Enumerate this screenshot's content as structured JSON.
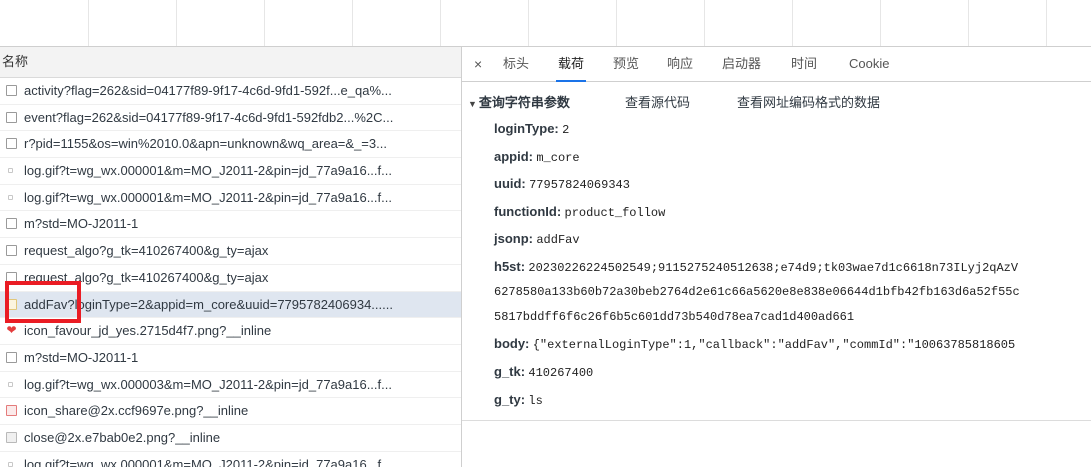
{
  "list": {
    "header": "名称",
    "rows": [
      {
        "name": "activity?flag=262&sid=04177f89-9f17-4c6d-9fd1-592f...e_qa%...",
        "icon": "document-icon"
      },
      {
        "name": "event?flag=262&sid=04177f89-9f17-4c6d-9fd1-592fdb2...%2C...",
        "icon": "document-icon"
      },
      {
        "name": "r?pid=1155&os=win%2010.0&apn=unknown&wq_area=&_=3...",
        "icon": "document-icon"
      },
      {
        "name": "log.gif?t=wg_wx.000001&m=MO_J2011-2&pin=jd_77a9a16...f...",
        "icon": "pixel-icon"
      },
      {
        "name": "log.gif?t=wg_wx.000001&m=MO_J2011-2&pin=jd_77a9a16...f...",
        "icon": "pixel-icon"
      },
      {
        "name": "m?std=MO-J2011-1",
        "icon": "document-icon"
      },
      {
        "name": "request_algo?g_tk=410267400&g_ty=ajax",
        "icon": "document-icon"
      },
      {
        "name": "request_algo?g_tk=410267400&g_ty=ajax",
        "icon": "document-icon"
      },
      {
        "name": "addFav?loginType=2&appid=m_core&uuid=7795782406934......",
        "icon": "script-icon"
      },
      {
        "name": "icon_favour_jd_yes.2715d4f7.png?__inline",
        "icon": "heart-icon"
      },
      {
        "name": "m?std=MO-J2011-1",
        "icon": "document-icon"
      },
      {
        "name": "log.gif?t=wg_wx.000003&m=MO_J2011-2&pin=jd_77a9a16...f...",
        "icon": "pixel-icon"
      },
      {
        "name": "icon_share@2x.ccf9697e.png?__inline",
        "icon": "image-icon"
      },
      {
        "name": "close@2x.e7bab0e2.png?__inline",
        "icon": "image-icon"
      },
      {
        "name": "log.gif?t=wg_wx.000001&m=MO_J2011-2&pin=jd_77a9a16...f...",
        "icon": "pixel-icon"
      }
    ]
  },
  "tabs": {
    "close": "×",
    "headers": "标头",
    "payload": "载荷",
    "preview": "预览",
    "response": "响应",
    "initiator": "启动器",
    "timing": "时间",
    "cookie": "Cookie"
  },
  "payload": {
    "section_title": "查询字符串参数",
    "view_source": "查看源代码",
    "view_url_encoded": "查看网址编码格式的数据",
    "params": [
      {
        "key": "loginType:",
        "value": "2"
      },
      {
        "key": "appid:",
        "value": "m_core"
      },
      {
        "key": "uuid:",
        "value": "77957824069343"
      },
      {
        "key": "functionId:",
        "value": "product_follow"
      },
      {
        "key": "jsonp:",
        "value": "addFav"
      },
      {
        "key": "h5st:",
        "value": "20230226224502549;9115275240512638;e74d9;tk03wae7d1c6618n73ILyj2qAzV"
      },
      {
        "key": "body:",
        "value": "{\"externalLoginType\":1,\"callback\":\"addFav\",\"commId\":\"10063785818605"
      },
      {
        "key": "g_tk:",
        "value": "410267400"
      },
      {
        "key": "g_ty:",
        "value": "ls"
      }
    ],
    "h5st_continued": [
      "6278580a133b60b72a30beb2764d2e61c66a5620e8e838e06644d1bfb42fb163d6a52f55c",
      "5817bddff6f6c26f6b5c601dd73b540d78ea7cad1d400ad661"
    ]
  }
}
